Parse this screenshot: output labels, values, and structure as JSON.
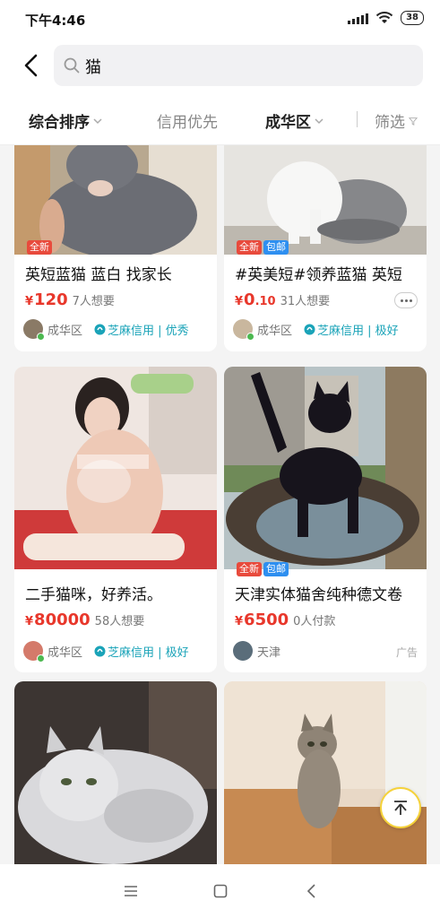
{
  "status_bar": {
    "time": "下午4:46",
    "battery": "38"
  },
  "search": {
    "query": "猫"
  },
  "filters": [
    {
      "label": "综合排序"
    },
    {
      "label": "信用优先"
    },
    {
      "label": "成华区"
    },
    {
      "label": "筛选"
    }
  ],
  "cards": [
    {
      "tags": [
        "全新"
      ],
      "title": "英短蓝猫 蓝白 找家长",
      "price_symbol": "¥",
      "price_int": "120",
      "price_dec": "",
      "want": "7人想要",
      "location": "成华区",
      "credit": "芝麻信用 | 优秀"
    },
    {
      "tags": [
        "全新",
        "包邮"
      ],
      "title": "#英美短#领养蓝猫 英短",
      "price_symbol": "¥",
      "price_int": "0",
      "price_dec": ".10",
      "want": "31人想要",
      "location": "成华区",
      "credit": "芝麻信用 | 极好"
    },
    {
      "tags": [],
      "title": "二手猫咪，好养活。",
      "price_symbol": "¥",
      "price_int": "80000",
      "price_dec": "",
      "want": "58人想要",
      "location": "成华区",
      "credit": "芝麻信用 | 极好"
    },
    {
      "tags": [
        "全新",
        "包邮"
      ],
      "title": "天津实体猫舍纯种德文卷",
      "price_symbol": "¥",
      "price_int": "6500",
      "price_dec": "",
      "want": "0人付款",
      "location": "天津",
      "ad": "广告"
    }
  ],
  "colors": {
    "price": "#e8372b",
    "credit": "#1aa3b8",
    "tag_new": "#e84a3c",
    "tag_ship": "#2e8ff0",
    "accent": "#f5d23a"
  },
  "icons": [
    "back-icon",
    "search-icon",
    "chevron-down-icon",
    "filter-icon",
    "more-icon",
    "sesame-credit-icon",
    "back-to-top-icon",
    "menu-icon",
    "home-icon",
    "back-nav-icon"
  ]
}
